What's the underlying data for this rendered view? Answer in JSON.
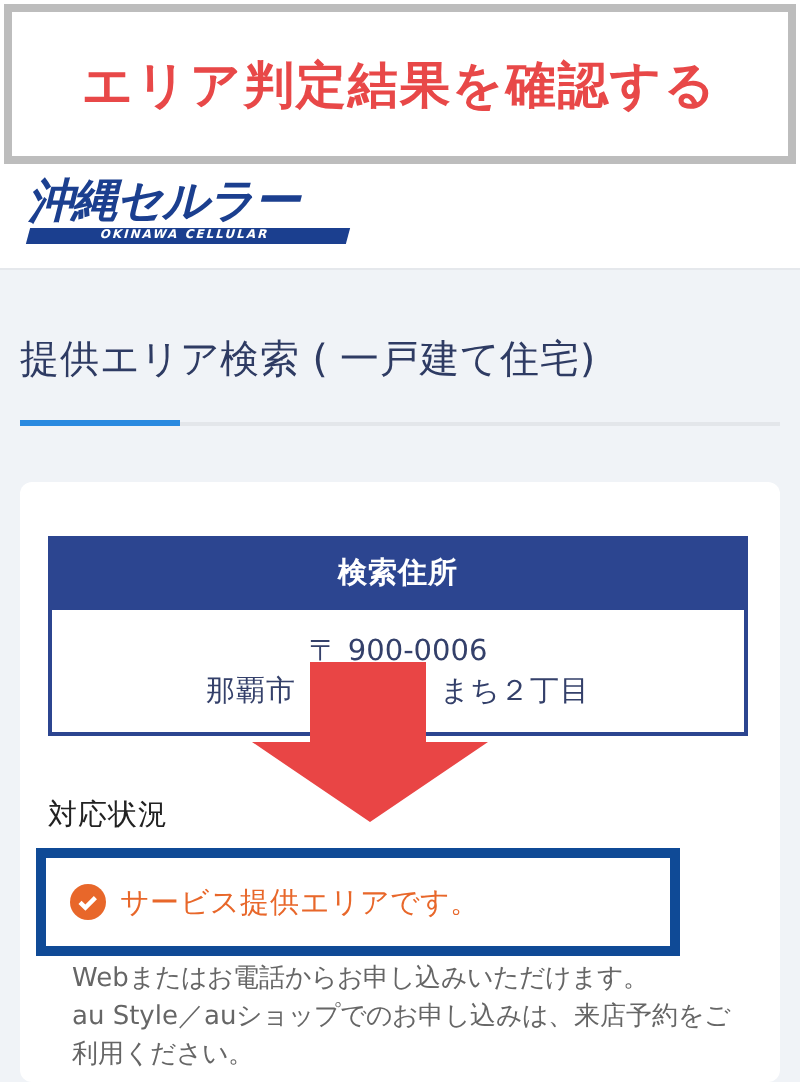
{
  "banner": {
    "text": "エリア判定結果を確認する"
  },
  "logo": {
    "name": "沖縄セルラー",
    "subtitle": "OKINAWA CELLULAR"
  },
  "page_title": "提供エリア検索 ( 一戸建て住宅)",
  "address": {
    "header": "検索住所",
    "postal": "〒 900-0006",
    "line_parts": [
      "那覇市",
      "まち２丁目"
    ]
  },
  "status": {
    "label": "対応状況",
    "kind": "available",
    "result": "サービス提供エリアです。",
    "description": [
      "Webまたはお電話からお申し込みいただけます。",
      "au Style／auショップでのお申し込みは、来店予約をご",
      "利用ください。"
    ]
  }
}
